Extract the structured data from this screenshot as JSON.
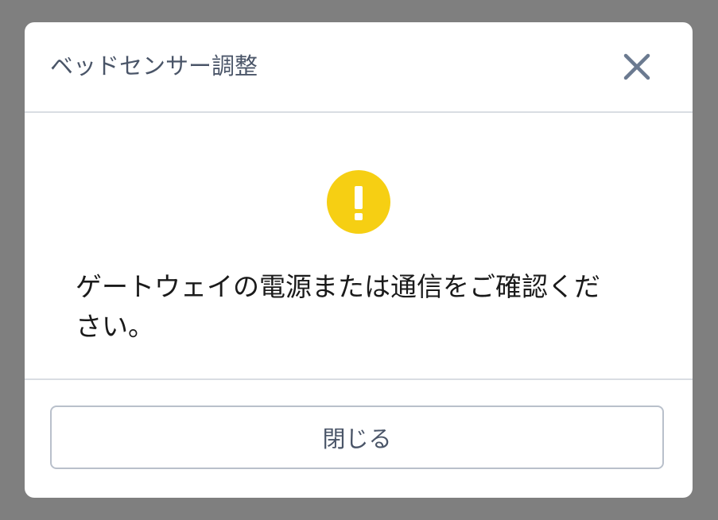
{
  "dialog": {
    "title": "ベッドセンサー調整",
    "close_icon": "close-icon",
    "warning_icon": "exclamation-circle-icon",
    "message": "ゲートウェイの電源または通信をご確認ください。",
    "close_button_label": "閉じる"
  },
  "colors": {
    "overlay": "#7f7f7f",
    "dialog_bg": "#ffffff",
    "title_text": "#4a5568",
    "close_icon": "#6b7a90",
    "warning": "#f6cf13",
    "message_text": "#1a1a1a",
    "divider": "#d9dde3",
    "button_border": "#b9c0cb"
  }
}
